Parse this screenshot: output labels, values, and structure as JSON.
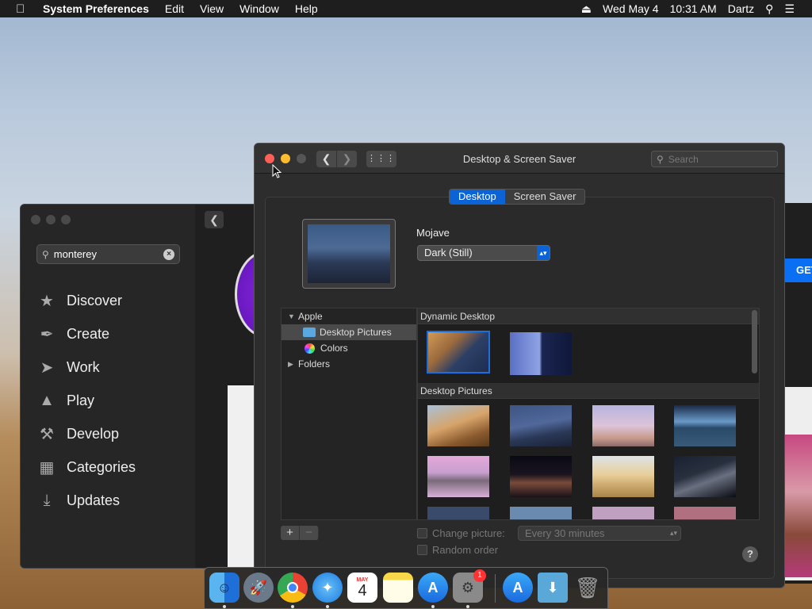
{
  "menubar": {
    "app": "System Preferences",
    "items": [
      "Edit",
      "View",
      "Window",
      "Help"
    ],
    "date": "Wed May 4",
    "time": "10:31 AM",
    "user": "Dartz"
  },
  "appstore": {
    "search_value": "monterey",
    "nav": [
      {
        "label": "Discover",
        "icon": "star-icon"
      },
      {
        "label": "Create",
        "icon": "brush-icon"
      },
      {
        "label": "Work",
        "icon": "paper-plane-icon"
      },
      {
        "label": "Play",
        "icon": "rocket-icon"
      },
      {
        "label": "Develop",
        "icon": "hammer-icon"
      },
      {
        "label": "Categories",
        "icon": "categories-icon"
      },
      {
        "label": "Updates",
        "icon": "download-icon"
      }
    ],
    "get_label": "GET"
  },
  "prefs": {
    "title": "Desktop & Screen Saver",
    "search_placeholder": "Search",
    "tabs": [
      "Desktop",
      "Screen Saver"
    ],
    "active_tab": "Desktop",
    "wallpaper_name": "Mojave",
    "appearance": "Dark (Still)",
    "sources": {
      "apple": "Apple",
      "desktop_pictures": "Desktop Pictures",
      "colors": "Colors",
      "folders": "Folders"
    },
    "sections": {
      "dynamic": "Dynamic Desktop",
      "pictures": "Desktop Pictures"
    },
    "change_picture_label": "Change picture:",
    "interval": "Every 30 minutes",
    "random_label": "Random order",
    "add": "+",
    "remove": "−",
    "help": "?"
  },
  "dock": {
    "calendar_month": "MAY",
    "calendar_day": "4",
    "badge": "1"
  }
}
